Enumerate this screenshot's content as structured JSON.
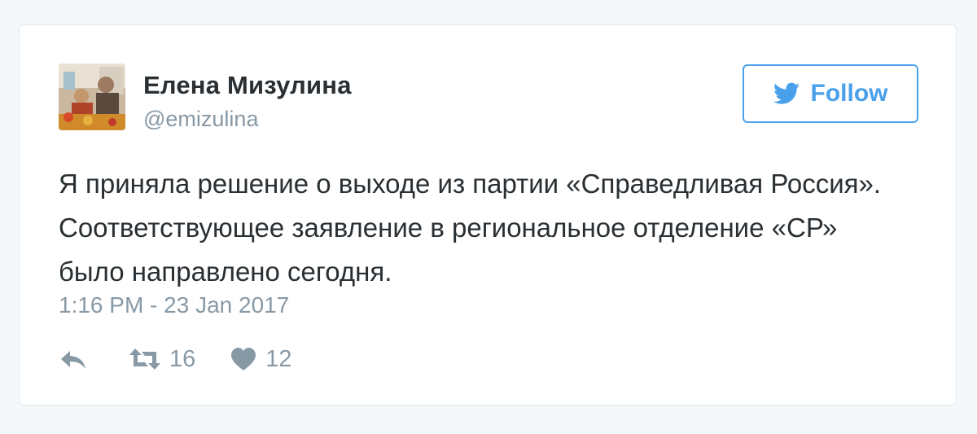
{
  "tweet": {
    "author": {
      "display_name": "Елена Мизулина",
      "handle": "@emizulina",
      "avatar_icon": "profile-photo"
    },
    "follow_button": {
      "label": "Follow",
      "icon": "twitter-bird-icon"
    },
    "text": "Я приняла решение о выходе из партии «Справедливая Россия». Соответствующее заявление в региональное отделение «СР» было направлено сегодня.",
    "timestamp": "1:16 PM - 23 Jan 2017",
    "actions": {
      "reply_icon": "reply-icon",
      "retweet_icon": "retweet-icon",
      "retweet_count": "16",
      "like_icon": "heart-icon",
      "like_count": "12"
    }
  },
  "colors": {
    "accent": "#4aa1eb",
    "text": "#292f33",
    "muted": "#8899a6",
    "border": "#e1e8ed"
  }
}
